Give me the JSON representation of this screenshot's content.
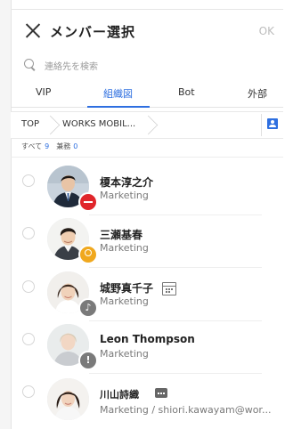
{
  "header": {
    "title": "メンバー選択",
    "ok_label": "OK"
  },
  "search": {
    "placeholder": "連絡先を検索"
  },
  "tabs": [
    {
      "label": "VIP"
    },
    {
      "label": "組織図",
      "active": true
    },
    {
      "label": "Bot"
    },
    {
      "label": "外部"
    }
  ],
  "breadcrumb": {
    "items": [
      "TOP",
      "WORKS MOBIL..."
    ]
  },
  "counts": {
    "all_label": "すべて",
    "all_value": "9",
    "concurrent_label": "兼務",
    "concurrent_value": "0"
  },
  "members": [
    {
      "name": "榎本淳之介",
      "dept": "Marketing",
      "status": "busy-badge"
    },
    {
      "name": "三瀬基春",
      "dept": "Marketing",
      "status": "away-badge"
    },
    {
      "name": "城野真千子",
      "dept": "Marketing",
      "status": "call-badge",
      "extra_icon": "calendar-icon"
    },
    {
      "name": "Leon Thompson",
      "dept": "Marketing",
      "status": "alert-badge"
    },
    {
      "name": "川山詩織",
      "dept": "Marketing / shiori.kawayam@wor...",
      "extra_icon": "message-icon"
    }
  ],
  "colors": {
    "accent": "#2e6fe0",
    "busy": "#e0262b",
    "away": "#f0a81e",
    "neutral_badge": "#7a7a7a"
  }
}
